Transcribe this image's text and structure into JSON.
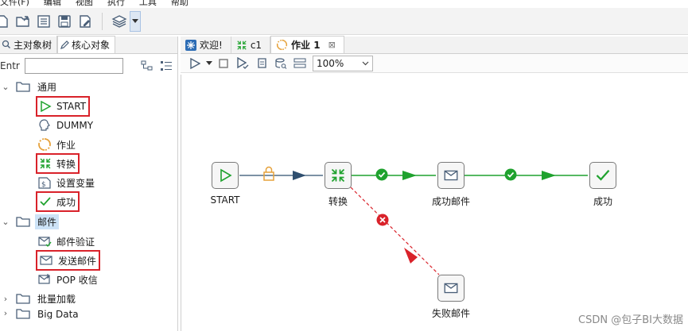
{
  "menu": [
    "文件(F)",
    "编辑",
    "视图",
    "执行",
    "工具",
    "帮助"
  ],
  "left_panel": {
    "tabs": [
      {
        "label": "主对象树",
        "icon": "tree-icon",
        "active": false
      },
      {
        "label": "核心对象",
        "icon": "pencil-icon",
        "active": true
      }
    ],
    "filter_label": "Entr",
    "filter_value": "",
    "tree": [
      {
        "type": "category",
        "label": "通用",
        "expanded": true,
        "selected": false
      },
      {
        "type": "item",
        "label": "START",
        "icon": "start-icon",
        "highlighted": true
      },
      {
        "type": "item",
        "label": "DUMMY",
        "icon": "dummy-icon",
        "highlighted": false
      },
      {
        "type": "item",
        "label": "作业",
        "icon": "job-icon",
        "highlighted": false
      },
      {
        "type": "item",
        "label": "转换",
        "icon": "transform-icon",
        "highlighted": true
      },
      {
        "type": "item",
        "label": "设置变量",
        "icon": "set-variable-icon",
        "highlighted": false
      },
      {
        "type": "item",
        "label": "成功",
        "icon": "success-icon",
        "highlighted": true
      },
      {
        "type": "category",
        "label": "邮件",
        "expanded": true,
        "selected": true
      },
      {
        "type": "item",
        "label": "邮件验证",
        "icon": "mail-verify-icon",
        "highlighted": false
      },
      {
        "type": "item",
        "label": "发送邮件",
        "icon": "mail-icon",
        "highlighted": true
      },
      {
        "type": "item",
        "label": "POP 收信",
        "icon": "pop-mail-icon",
        "highlighted": false
      },
      {
        "type": "category",
        "label": "批量加载",
        "expanded": false,
        "selected": false
      },
      {
        "type": "category",
        "label": "Big Data",
        "expanded": false,
        "selected": false
      }
    ]
  },
  "editor": {
    "tabs": [
      {
        "label": "欢迎!",
        "icon": "welcome-icon",
        "active": false
      },
      {
        "label": "c1",
        "icon": "transform-icon",
        "active": false
      },
      {
        "label": "作业 1",
        "icon": "job-icon",
        "active": true,
        "closable": true
      }
    ],
    "zoom": "100%"
  },
  "job": {
    "nodes": [
      {
        "id": "start",
        "label": "START",
        "icon": "start-icon"
      },
      {
        "id": "transform",
        "label": "转换",
        "icon": "transform-icon"
      },
      {
        "id": "success-mail",
        "label": "成功邮件",
        "icon": "mail-icon"
      },
      {
        "id": "success",
        "label": "成功",
        "icon": "success-icon"
      },
      {
        "id": "fail-mail",
        "label": "失败邮件",
        "icon": "mail-icon"
      }
    ],
    "hops": [
      {
        "from": "start",
        "to": "transform",
        "kind": "unconditional",
        "color": "#2f4f6f"
      },
      {
        "from": "transform",
        "to": "success-mail",
        "kind": "success",
        "color": "#1fa22e"
      },
      {
        "from": "success-mail",
        "to": "success",
        "kind": "success",
        "color": "#1fa22e"
      },
      {
        "from": "transform",
        "to": "fail-mail",
        "kind": "failure",
        "color": "#d9222a"
      }
    ]
  },
  "colors": {
    "highlight": "#d9222a",
    "success": "#1fa22e",
    "failure": "#d9222a",
    "selection": "#cde3f7"
  },
  "watermark": "CSDN @包子BI大数据"
}
